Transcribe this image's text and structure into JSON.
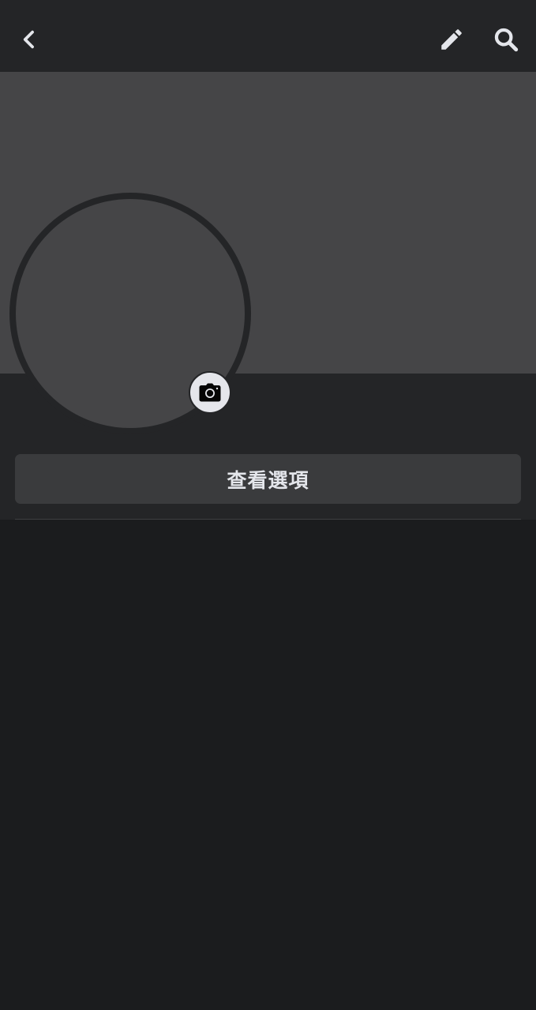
{
  "header": {
    "back_icon": "chevron-left-icon",
    "edit_icon": "pencil-icon",
    "search_icon": "search-icon"
  },
  "profile": {
    "camera_icon": "camera-icon",
    "options_button_label": "查看選項"
  },
  "colors": {
    "background": "#1b1c1e",
    "surface": "#242527",
    "placeholder": "#454547",
    "button_bg": "#3a3b3d",
    "text": "#e4e6eb"
  }
}
